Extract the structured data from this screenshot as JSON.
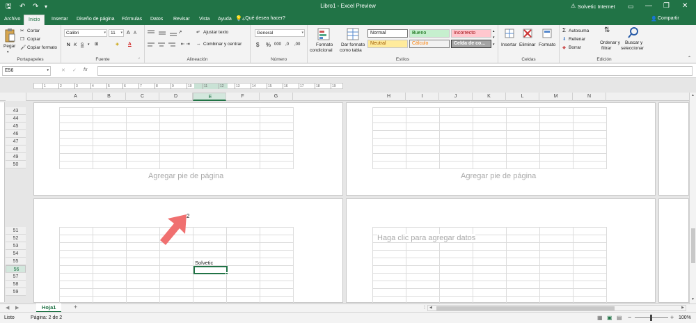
{
  "window": {
    "title": "Libro1 - Excel Preview",
    "user": "Solvetic Internet",
    "minimize_glyph": "—",
    "maximize_glyph": "❐",
    "close_glyph": "✕"
  },
  "quick_access": {
    "save_glyph": "🖫",
    "undo_glyph": "↶",
    "redo_glyph": "↷",
    "custom_glyph": "▾"
  },
  "tabs": [
    "Archivo",
    "Inicio",
    "Insertar",
    "Diseño de página",
    "Fórmulas",
    "Datos",
    "Revisar",
    "Vista",
    "Ayuda"
  ],
  "active_tab": "Inicio",
  "tell_me": "¿Qué desea hacer?",
  "share": "Compartir",
  "ribbon": {
    "portapapeles": {
      "label": "Portapapeles",
      "paste": "Pegar",
      "cut": "Cortar",
      "copy": "Copiar",
      "format_painter": "Copiar formato"
    },
    "fuente": {
      "label": "Fuente",
      "font_name": "Calibri",
      "font_size": "11",
      "bold": "N",
      "italic": "K",
      "underline": "S",
      "grow": "A",
      "shrink": "A"
    },
    "alineacion": {
      "label": "Alineación",
      "wrap": "Ajustar texto",
      "merge": "Combinar y centrar"
    },
    "numero": {
      "label": "Número",
      "format": "General",
      "currency": "$",
      "percent": "%",
      "thousands": "000",
      "dec_more": ",0",
      "dec_less": ",00"
    },
    "estilos": {
      "label": "Estilos",
      "conditional": [
        "Formato",
        "condicional"
      ],
      "as_table": [
        "Dar formato",
        "como tabla"
      ],
      "cells": [
        "Normal",
        "Bueno",
        "Incorrecto",
        "Neutral",
        "Cálculo",
        "Celda de co..."
      ]
    },
    "celdas": {
      "label": "Celdas",
      "insert": "Insertar",
      "delete": "Eliminar",
      "format": "Formato"
    },
    "edicion": {
      "label": "Edición",
      "autosum": "Autosuma",
      "fill": "Rellenar",
      "clear": "Borrar",
      "sort": [
        "Ordenar y",
        "filtrar"
      ],
      "find": [
        "Buscar y",
        "seleccionar"
      ]
    }
  },
  "formula_bar": {
    "name_box": "E56",
    "fx": "fx",
    "cancel": "✕",
    "enter": "✓",
    "formula": ""
  },
  "ruler": [
    "1",
    "2",
    "3",
    "4",
    "5",
    "6",
    "7",
    "8",
    "9",
    "10",
    "11",
    "12",
    "13",
    "14",
    "15",
    "16",
    "17",
    "18",
    "19"
  ],
  "columns_left": [
    "A",
    "B",
    "C",
    "D",
    "E",
    "F",
    "G"
  ],
  "columns_right": [
    "H",
    "I",
    "J",
    "K",
    "L",
    "M",
    "N"
  ],
  "selected_column": "E",
  "rows_top": [
    "43",
    "44",
    "45",
    "46",
    "47",
    "48",
    "49",
    "50"
  ],
  "rows_bottom": [
    "51",
    "52",
    "53",
    "54",
    "55",
    "56",
    "57",
    "58",
    "59"
  ],
  "selected_row": "56",
  "pages": {
    "footer_left": "Agregar pie de página",
    "footer_right": "Agregar pie de página",
    "page_number": "2",
    "add_data_hint": "Haga clic para agregar datos",
    "cell_e55": "Solvetic"
  },
  "sheet_tabs": {
    "active": "Hoja1",
    "add": "+"
  },
  "status": {
    "ready": "Listo",
    "page": "Página: 2 de 2",
    "zoom": "100%",
    "zoom_minus": "−",
    "zoom_plus": "+"
  },
  "colors": {
    "brand": "#217346",
    "arrow": "#f07070"
  }
}
